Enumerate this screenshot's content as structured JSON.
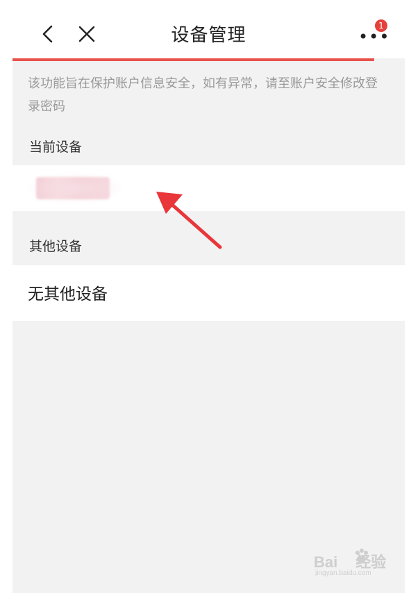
{
  "header": {
    "title": "设备管理",
    "badge_count": "1"
  },
  "notice": {
    "text": "该功能旨在保护账户信息安全，如有异常，请至账户安全修改登录密码"
  },
  "sections": {
    "current_label": "当前设备",
    "other_label": "其他设备",
    "no_other_text": "无其他设备"
  },
  "icons": {
    "back": "chevron-left-icon",
    "close": "close-icon",
    "more": "more-dots-icon"
  },
  "watermark": {
    "logo": "Bai",
    "logo2": "经验",
    "sub": "jingyan.baidu.com"
  },
  "colors": {
    "accent": "#e8524c",
    "badge": "#e5403b",
    "arrow": "#e8363a",
    "background": "#f2f2f2"
  }
}
